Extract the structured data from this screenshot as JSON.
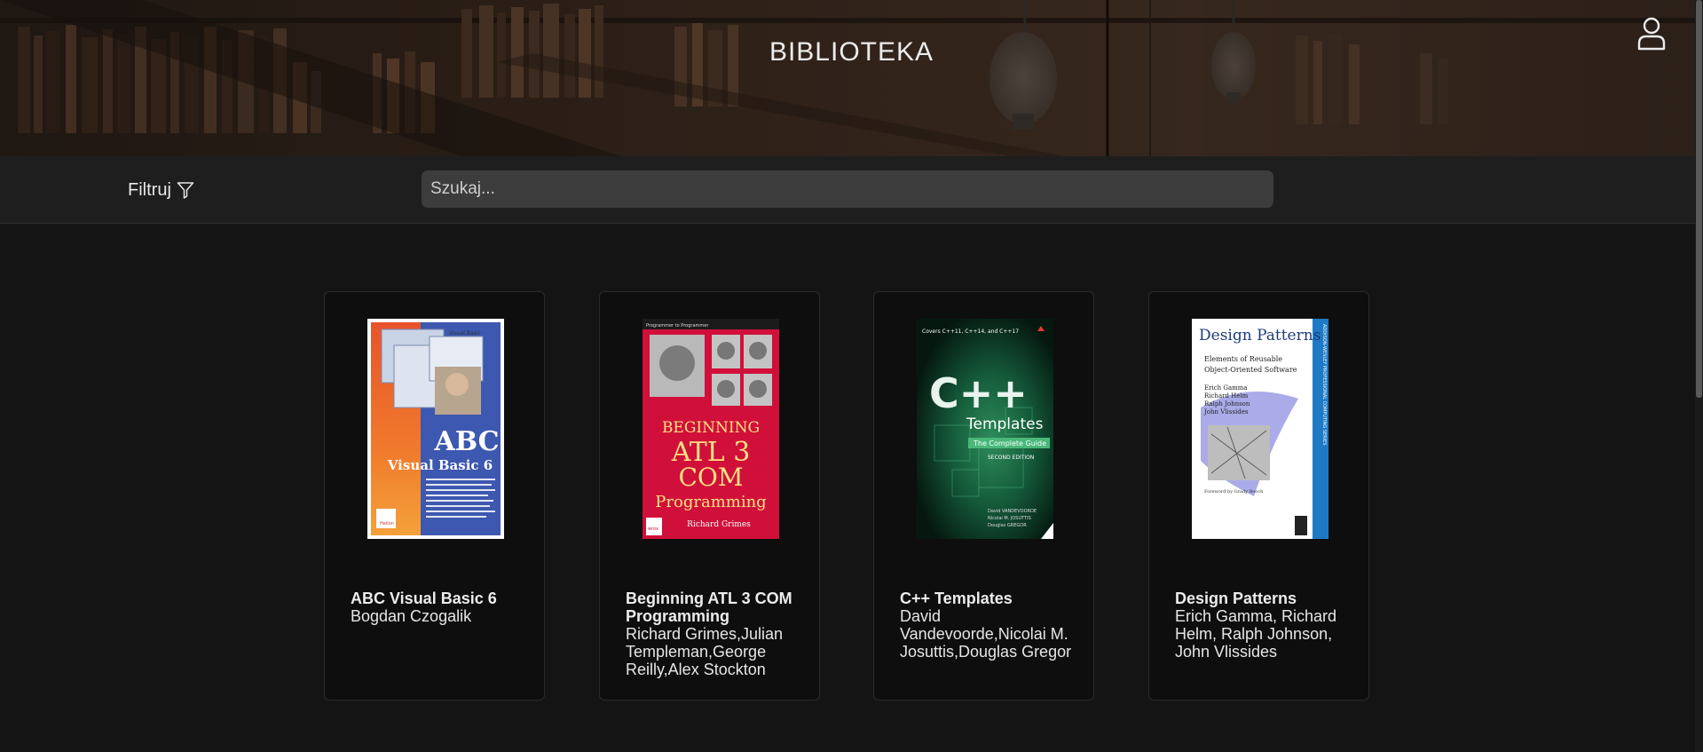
{
  "header": {
    "title": "BIBLIOTEKA",
    "user_icon": "user-icon"
  },
  "toolbar": {
    "filter_label": "Filtruj",
    "filter_icon": "funnel-icon",
    "search_placeholder": "Szukaj...",
    "search_value": ""
  },
  "books": [
    {
      "title": "ABC Visual Basic 6",
      "author": "Bogdan Czogalik",
      "cover": {
        "top_text": "Visual Basic",
        "main_text": "ABC",
        "sub_text": "Visual Basic 6",
        "publisher": "Helion"
      }
    },
    {
      "title": "Beginning ATL 3 COM Programming",
      "author": "Richard Grimes,Julian Templeman,George Reilly,Alex Stockton",
      "cover": {
        "top_text": "Programmer to Programmer",
        "line1": "BEGINNING",
        "line2": "ATL 3",
        "line3": "COM",
        "line4": "Programming",
        "author_line": "Richard Grimes",
        "publisher": "wrox"
      }
    },
    {
      "title": "C++ Templates",
      "author": "David Vandevoorde,Nicolai M. Josuttis,Douglas Gregor",
      "cover": {
        "top_text": "Covers C++11, C++14, and C++17",
        "main_text": "C++",
        "sub_text": "Templates",
        "band_text": "The Complete Guide",
        "edition": "SECOND EDITION",
        "authors": [
          "David VANDEVOORDE",
          "Nicolai M. JOSUTTIS",
          "Douglas GREGOR"
        ]
      }
    },
    {
      "title": "Design Patterns",
      "author": "Erich Gamma, Richard Helm, Ralph Johnson, John Vlissides",
      "cover": {
        "main_text": "Design Patterns",
        "sub_line1": "Elements of Reusable",
        "sub_line2": "Object-Oriented Software",
        "authors": [
          "Erich Gamma",
          "Richard Helm",
          "Ralph Johnson",
          "John Vlissides"
        ],
        "foreword": "Foreword by Grady Booch",
        "series": "ADDISON-WESLEY PROFESSIONAL COMPUTING SERIES"
      }
    }
  ]
}
